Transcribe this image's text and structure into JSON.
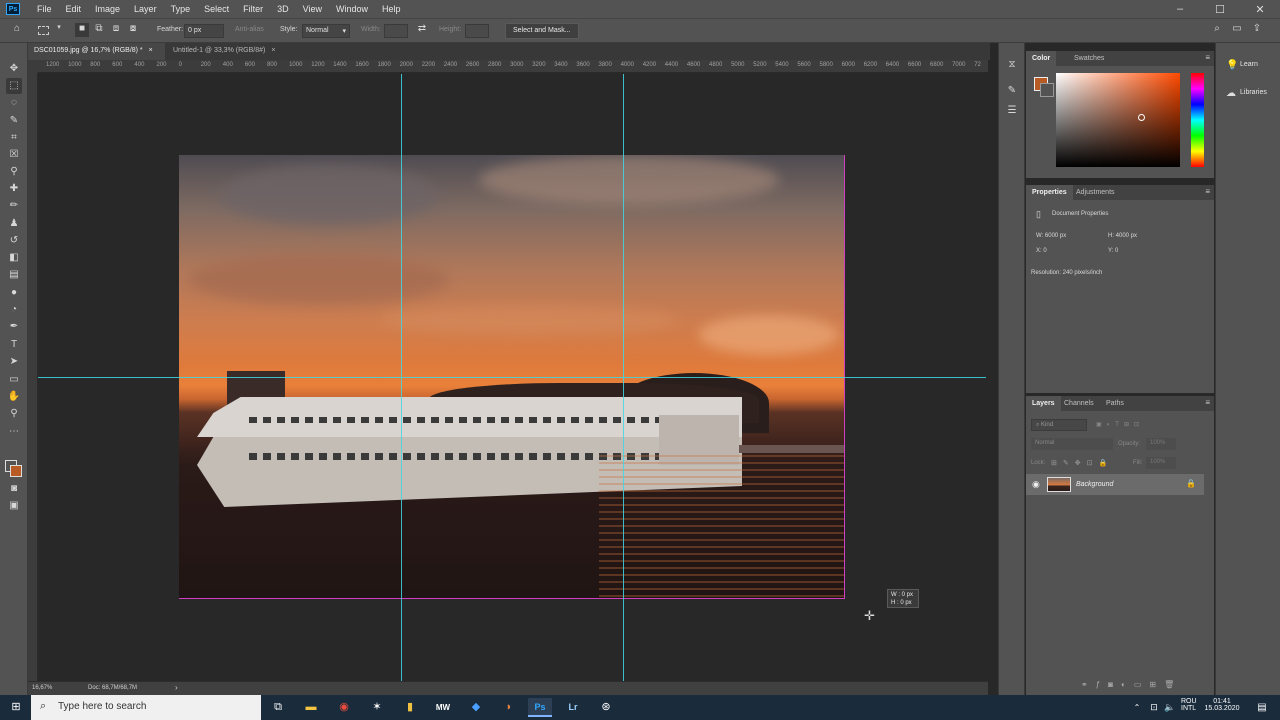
{
  "app": {
    "logo": "Ps",
    "menu": [
      "File",
      "Edit",
      "Image",
      "Layer",
      "Type",
      "Select",
      "Filter",
      "3D",
      "View",
      "Window",
      "Help"
    ],
    "window_controls": {
      "minimize": "–",
      "maximize": "☐",
      "close": "✕"
    }
  },
  "options_bar": {
    "feather_label": "Feather:",
    "feather_value": "0 px",
    "anti_alias": "Anti-alias",
    "style_label": "Style:",
    "style_value": "Normal",
    "width_label": "Width:",
    "height_label": "Height:",
    "select_mask": "Select and Mask..."
  },
  "tabs": [
    {
      "label": "DSC01059.jpg @ 16,7% (RGB/8) *",
      "close": "×"
    },
    {
      "label": "Untitled-1 @ 33,3% (RGB/8#)",
      "close": "×"
    }
  ],
  "ruler_ticks": [
    "1200",
    "1000",
    "800",
    "600",
    "400",
    "200",
    "0",
    "200",
    "400",
    "600",
    "800",
    "1000",
    "1200",
    "1400",
    "1600",
    "1800",
    "2000",
    "2200",
    "2400",
    "2600",
    "2800",
    "3000",
    "3200",
    "3400",
    "3600",
    "3800",
    "4000",
    "4200",
    "4400",
    "4600",
    "4800",
    "5000",
    "5200",
    "5400",
    "5600",
    "5800",
    "6000",
    "6200",
    "6400",
    "6600",
    "6800",
    "7000",
    "72"
  ],
  "canvas": {
    "tooltip_w": "W : 0 px",
    "tooltip_h": "H : 0 px",
    "cursor": "✛"
  },
  "status": {
    "zoom": "16,67%",
    "doc": "Doc: 68,7M/68,7M",
    "arrow": "›"
  },
  "side_buttons": {
    "learn": "Learn",
    "libraries": "Libraries"
  },
  "color_panel": {
    "tabs": [
      "Color",
      "Swatches"
    ],
    "foreground": "#b85a24",
    "hue_color": "#ff4a00"
  },
  "properties_panel": {
    "tabs": [
      "Properties",
      "Adjustments"
    ],
    "title": "Document Properties",
    "w": "W:  6000 px",
    "h": "H:  4000 px",
    "x": "X:  0",
    "y": "Y:  0",
    "resolution": "Resolution: 240 pixels/inch"
  },
  "layers_panel": {
    "tabs": [
      "Layers",
      "Channels",
      "Paths"
    ],
    "kind": "Kind",
    "blend": "Normal",
    "opacity_label": "Opacity:",
    "opacity_value": "100%",
    "lock_label": "Lock:",
    "fill_label": "Fill:",
    "fill_value": "100%",
    "layer_name": "Background"
  },
  "taskbar": {
    "search_placeholder": "Type here to search",
    "lang": "ROU",
    "lang2": "INTL",
    "time": "01:41",
    "date": "15.03.2020"
  }
}
